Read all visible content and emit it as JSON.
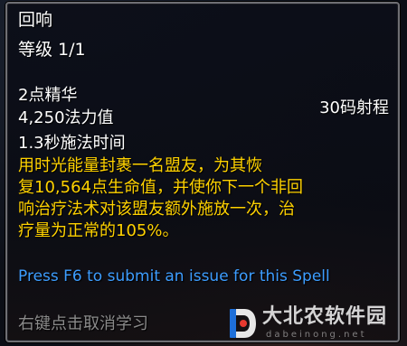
{
  "tooltip": {
    "spell_name": "回响",
    "rank": "等级 1/1",
    "cost_primary": "2点精华",
    "cost_secondary": "4,250法力值",
    "range": "30码射程",
    "cast_time": "1.3秒施法时间",
    "description_lines": [
      "用时光能量封裹一名盟友，为其恢",
      "复10,564点生命值，并使你下一个非回",
      "响治疗法术对该盟友额外施放一次，治",
      "疗量为正常的105%。"
    ],
    "report_text": "Press F6 to submit an issue for this Spell",
    "cancel_hint": "右键点击取消学习"
  },
  "watermark": {
    "name": "大北农软件园",
    "url": "dabeinong.net"
  },
  "colors": {
    "title": "#ffffff",
    "description": "#ffd200",
    "report_link": "#3d9dff",
    "hint": "#8a8a8a",
    "border": "#6f6f74"
  }
}
